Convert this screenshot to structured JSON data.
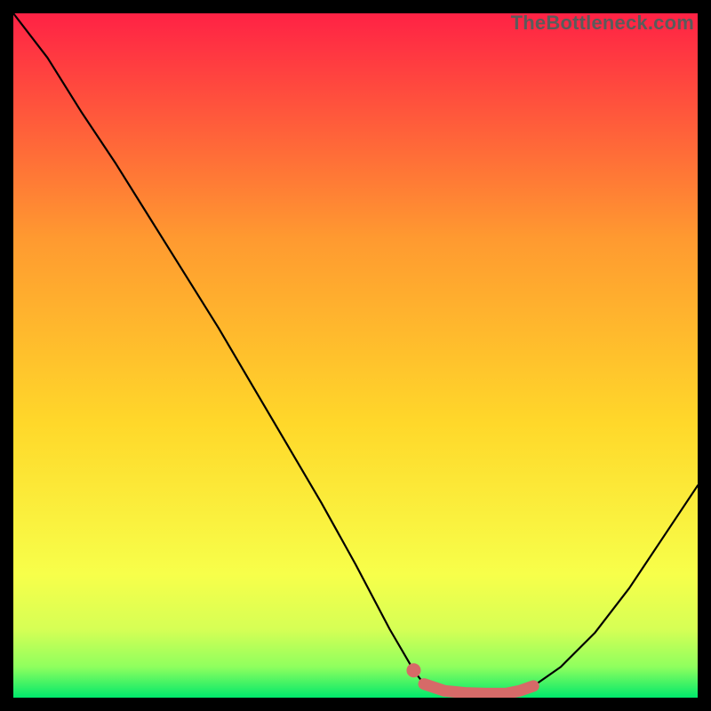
{
  "watermark": "TheBottleneck.com",
  "colors": {
    "bg_black": "#000000",
    "gradient_top": "#ff2245",
    "gradient_mid1": "#ff6a3a",
    "gradient_mid2": "#ffd82a",
    "gradient_mid3": "#f7ff4a",
    "gradient_bottom": "#00e86b",
    "curve": "#000000",
    "highlight": "#d66a68",
    "watermark": "#5b5b5b"
  },
  "chart_data": {
    "type": "line",
    "title": "",
    "xlabel": "",
    "ylabel": "",
    "xlim": [
      0,
      100
    ],
    "ylim": [
      0,
      100
    ],
    "grid": false,
    "legend": false,
    "series": [
      {
        "name": "bottleneck-curve",
        "x": [
          0,
          5,
          10,
          15,
          20,
          25,
          30,
          35,
          40,
          45,
          50,
          55,
          58.5,
          60,
          65,
          68,
          72,
          76,
          80,
          85,
          90,
          95,
          100
        ],
        "y": [
          100,
          93.5,
          85.5,
          78.0,
          70.0,
          62.0,
          54.0,
          45.5,
          37.0,
          28.5,
          19.5,
          10.0,
          4.0,
          2.0,
          0.8,
          0.6,
          0.6,
          1.7,
          4.5,
          9.5,
          16.0,
          23.5,
          31.0
        ]
      }
    ],
    "highlight_segment": {
      "comment": "thicker salmon segment + dot near the minimum",
      "dot": {
        "x": 58.5,
        "y": 4.0
      },
      "x": [
        60,
        63,
        66,
        69,
        72,
        74,
        76
      ],
      "y": [
        2.0,
        1.0,
        0.7,
        0.6,
        0.6,
        1.0,
        1.7
      ]
    },
    "background_gradient_stops": [
      {
        "offset": 0.0,
        "color": "#ff2245"
      },
      {
        "offset": 0.33,
        "color": "#ff9a30"
      },
      {
        "offset": 0.6,
        "color": "#ffd82a"
      },
      {
        "offset": 0.82,
        "color": "#f7ff4a"
      },
      {
        "offset": 0.9,
        "color": "#d6ff55"
      },
      {
        "offset": 0.955,
        "color": "#8fff5e"
      },
      {
        "offset": 1.0,
        "color": "#00e86b"
      }
    ]
  }
}
